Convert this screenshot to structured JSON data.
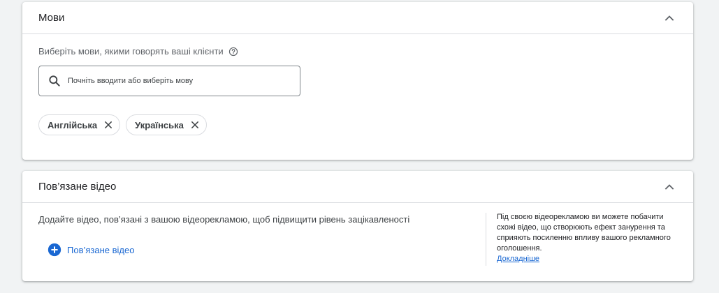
{
  "languages": {
    "title": "Мови",
    "prompt": "Виберіть мови, якими говорять ваші клієнти",
    "search_placeholder": "Почніть вводити або виберіть мову",
    "chips": [
      {
        "label": "Англійська"
      },
      {
        "label": "Українська"
      }
    ]
  },
  "related_video": {
    "title": "Пов’язане відео",
    "description": "Додайте відео, пов’язані з вашою відеорекламою, щоб підвищити рівень зацікавленості",
    "add_label": "Пов’язане відео",
    "info_text": "Під своєю відеорекламою ви можете побачити схожі відео, що створюють ефект занурення та сприяють посиленню впливу вашого рекламного оголошення.",
    "learn_more": "Докладніше"
  },
  "colors": {
    "accent": "#1967d2",
    "background": "#f1f3f4",
    "border": "#dadce0"
  },
  "icons": [
    "chevron-up-icon",
    "help-icon",
    "search-icon",
    "close-icon",
    "add-circle-icon"
  ]
}
